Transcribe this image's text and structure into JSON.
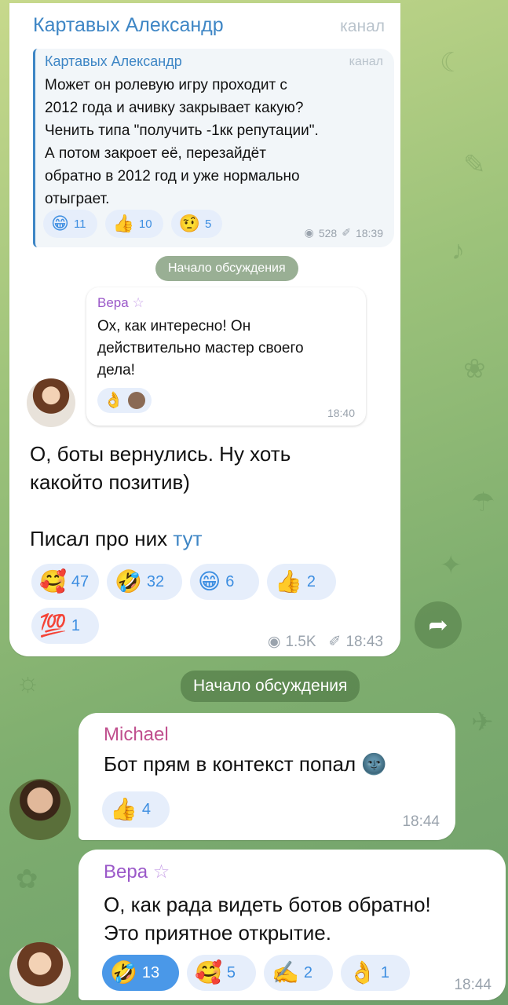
{
  "channel_post": {
    "author": "Картавых Александр",
    "tag": "канал",
    "quoted": {
      "author": "Картавых Александр",
      "tag": "канал",
      "text_lines": [
        "Может он ролевую игру проходит с",
        "2012 года и ачивку закрывает какую?",
        "Ченить типа \"получить -1кк репутации\".",
        "А потом закроет её, перезайдёт",
        "обратно в 2012 год и уже нормально",
        "отыграет."
      ],
      "reactions": [
        {
          "emoji": "😁",
          "count": "11"
        },
        {
          "emoji": "👍",
          "count": "10"
        },
        {
          "emoji": "🤨",
          "count": "5"
        }
      ],
      "views": "528",
      "time": "18:39"
    },
    "discussion_label": "Начало обсуждения",
    "reply": {
      "author": "Вера",
      "text_lines": [
        "Ох, как интересно! Он",
        "действительно мастер своего",
        "дела!"
      ],
      "reactions": [
        {
          "emoji": "👌"
        }
      ],
      "time": "18:40"
    },
    "text_lines": [
      "О, боты вернулись. Ну хоть",
      "какойто позитив)"
    ],
    "text2": "Писал про них",
    "link": "тут",
    "reactions": [
      {
        "emoji": "🥰",
        "count": "47"
      },
      {
        "emoji": "🤣",
        "count": "32"
      },
      {
        "emoji": "😁",
        "count": "6"
      },
      {
        "emoji": "👍",
        "count": "2"
      },
      {
        "emoji": "💯",
        "count": "1"
      }
    ],
    "views": "1.5K",
    "time": "18:43"
  },
  "discussion_label": "Начало обсуждения",
  "michael": {
    "author": "Michael",
    "text": "Бот прям в контекст попал",
    "text_emoji": "🌚",
    "reaction": {
      "emoji": "👍",
      "count": "4"
    },
    "time": "18:44"
  },
  "vera": {
    "author": "Вера",
    "text_lines": [
      "О, как рада видеть ботов обратно!",
      "Это приятное открытие."
    ],
    "reactions": [
      {
        "emoji": "🤣",
        "count": "13"
      },
      {
        "emoji": "🥰",
        "count": "5"
      },
      {
        "emoji": "✍️",
        "count": "2"
      },
      {
        "emoji": "👌",
        "count": "1"
      }
    ],
    "time": "18:44"
  },
  "icons": {
    "views": "eye-icon",
    "pin": "pin-icon",
    "forward": "share-arrow-icon",
    "star": "star-icon"
  },
  "colors": {
    "name_blue": "#3e86c5",
    "michael_pink": "#c0508e",
    "vera_purple": "#9b59c9",
    "reaction_blue": "#3d8ee1"
  }
}
